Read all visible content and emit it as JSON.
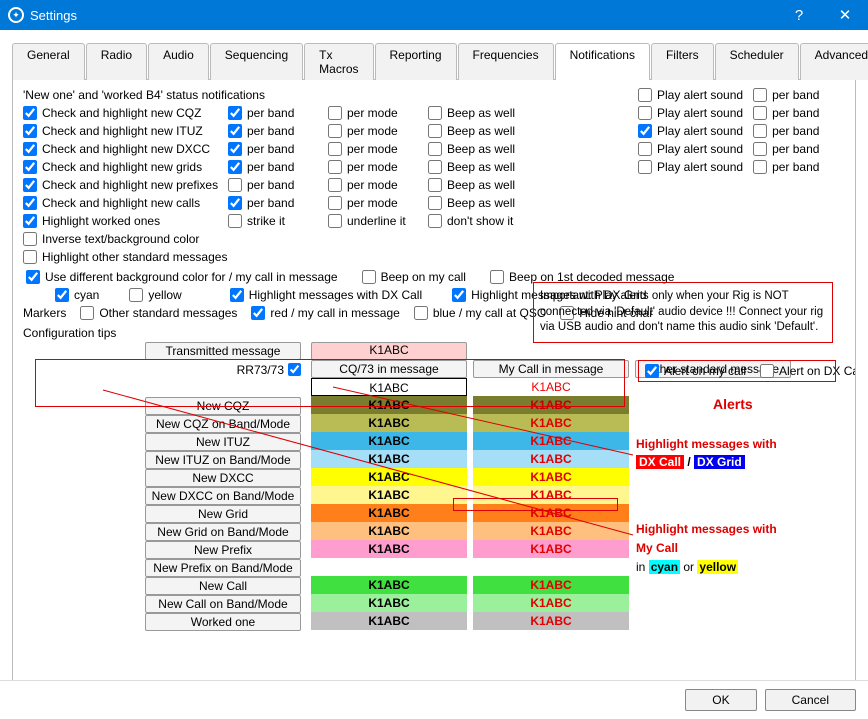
{
  "window": {
    "title": "Settings"
  },
  "tabs": [
    "General",
    "Radio",
    "Audio",
    "Sequencing",
    "Tx Macros",
    "Reporting",
    "Frequencies",
    "Notifications",
    "Filters",
    "Scheduler",
    "Advanced"
  ],
  "active_tab": "Notifications",
  "section": "'New one' and 'worked B4' status notifications",
  "checks": {
    "rows": [
      {
        "c0": {
          "t": "Check and highlight new CQZ",
          "v": true
        },
        "c1": {
          "t": "per band",
          "v": true
        },
        "c2": {
          "t": "per mode",
          "v": false
        },
        "c3": {
          "t": "Beep as well",
          "v": false
        }
      },
      {
        "c0": {
          "t": "Check and highlight new ITUZ",
          "v": true
        },
        "c1": {
          "t": "per band",
          "v": true
        },
        "c2": {
          "t": "per mode",
          "v": false
        },
        "c3": {
          "t": "Beep as well",
          "v": false
        }
      },
      {
        "c0": {
          "t": "Check and highlight new DXCC",
          "v": true
        },
        "c1": {
          "t": "per band",
          "v": true
        },
        "c2": {
          "t": "per mode",
          "v": false
        },
        "c3": {
          "t": "Beep as well",
          "v": false
        }
      },
      {
        "c0": {
          "t": "Check and highlight new grids",
          "v": true
        },
        "c1": {
          "t": "per band",
          "v": true
        },
        "c2": {
          "t": "per mode",
          "v": false
        },
        "c3": {
          "t": "Beep as well",
          "v": false
        }
      },
      {
        "c0": {
          "t": "Check and highlight new prefixes",
          "v": true
        },
        "c1": {
          "t": "per band",
          "v": false
        },
        "c2": {
          "t": "per mode",
          "v": false
        },
        "c3": {
          "t": "Beep as well",
          "v": false
        }
      },
      {
        "c0": {
          "t": "Check and highlight new calls",
          "v": true
        },
        "c1": {
          "t": "per band",
          "v": true
        },
        "c2": {
          "t": "per mode",
          "v": false
        },
        "c3": {
          "t": "Beep as well",
          "v": false
        }
      },
      {
        "c0": {
          "t": "Highlight worked ones",
          "v": true
        },
        "c1": {
          "t": "strike it",
          "v": false
        },
        "c2": {
          "t": "underline it",
          "v": false
        },
        "c3": {
          "t": "don't show it",
          "v": false
        }
      },
      {
        "c0": {
          "t": "Inverse text/background color",
          "v": false
        }
      },
      {
        "c0": {
          "t": "Highlight other standard messages",
          "v": false
        }
      }
    ],
    "diff_bg": {
      "t": "Use different background color for / my call in message",
      "v": true
    },
    "beep_mycall": {
      "t": "Beep on my call",
      "v": false
    },
    "beep_first": {
      "t": "Beep on 1st decoded message",
      "v": false
    },
    "cyan": {
      "t": "cyan",
      "v": true
    },
    "yellow": {
      "t": "yellow",
      "v": false
    },
    "hl_dxcall": {
      "t": "Highlight messages with DX Call",
      "v": true
    },
    "hl_dxgrid": {
      "t": "Highlight messages with DX Grid",
      "v": true
    },
    "alert_mycall": {
      "t": "Alert on my call",
      "v": true
    },
    "alert_dxcall": {
      "t": "Alert on DX Call",
      "v": false
    }
  },
  "alerts_rows": [
    {
      "play": {
        "t": "Play alert sound",
        "v": false
      },
      "pb": {
        "t": "per band",
        "v": false
      }
    },
    {
      "play": {
        "t": "Play alert sound",
        "v": false
      },
      "pb": {
        "t": "per band",
        "v": false
      }
    },
    {
      "play": {
        "t": "Play alert sound",
        "v": true
      },
      "pb": {
        "t": "per band",
        "v": false
      }
    },
    {
      "play": {
        "t": "Play alert sound",
        "v": false
      },
      "pb": {
        "t": "per band",
        "v": false
      }
    },
    {
      "play": {
        "t": "Play alert sound",
        "v": false
      },
      "pb": {
        "t": "per band",
        "v": false
      }
    }
  ],
  "important": "Important: Play alerts only when your Rig is NOT connected via 'Default' audio device !!! Connect your rig via USB audio and don't name this audio sink 'Default'.",
  "markers": {
    "label": "Markers",
    "other": {
      "t": "Other standard messages",
      "v": false
    },
    "red": {
      "t": "red / my call in message",
      "v": true
    },
    "blue": {
      "t": "blue / my call at QSO",
      "v": false
    },
    "hide": {
      "t": "Hide hint char",
      "v": false
    }
  },
  "cfg_tips": "Configuration tips",
  "hdr": {
    "tx": "Transmitted message",
    "cq": "CQ/73 in message",
    "my": "My Call in message",
    "other": "Other standard message",
    "rr": "RR73/73",
    "rrv": true
  },
  "btns": [
    "New CQZ",
    "New CQZ on Band/Mode",
    "New ITUZ",
    "New ITUZ on Band/Mode",
    "New DXCC",
    "New DXCC on Band/Mode",
    "New Grid",
    "New Grid on Band/Mode",
    "New Prefix",
    "New Prefix on Band/Mode",
    "New Call",
    "New Call on Band/Mode",
    "Worked one"
  ],
  "call": "K1ABC",
  "colors": {
    "rows": [
      {
        "l": {
          "bg": "#ffffff",
          "fg": "#000000",
          "b": 1
        },
        "r": {
          "bg": "#ffffff",
          "fg": "#f00000"
        }
      },
      {
        "l": {
          "bg": "#7a7c2e",
          "fg": "#000000"
        },
        "r": {
          "bg": "#7a7c2e",
          "fg": "#c00000"
        }
      },
      {
        "l": {
          "bg": "#b9bb55",
          "fg": "#000000"
        },
        "r": {
          "bg": "#b9bb55",
          "fg": "#e00000"
        }
      },
      {
        "l": {
          "bg": "#3db7e8",
          "fg": "#000000"
        },
        "r": {
          "bg": "#3db7e8",
          "fg": "#e00000"
        }
      },
      {
        "l": {
          "bg": "#a5dff7",
          "fg": "#000000"
        },
        "r": {
          "bg": "#a5dff7",
          "fg": "#e00000"
        }
      },
      {
        "l": {
          "bg": "#ffff00",
          "fg": "#000000"
        },
        "r": {
          "bg": "#ffff00",
          "fg": "#e00000"
        }
      },
      {
        "l": {
          "bg": "#fff68f",
          "fg": "#000000"
        },
        "r": {
          "bg": "#fff68f",
          "fg": "#e00000"
        }
      },
      {
        "l": {
          "bg": "#ff7f1a",
          "fg": "#000000"
        },
        "r": {
          "bg": "#ff7f1a",
          "fg": "#e00000"
        }
      },
      {
        "l": {
          "bg": "#ffc07f",
          "fg": "#000000"
        },
        "r": {
          "bg": "#ffc07f",
          "fg": "#e00000"
        }
      },
      {
        "l": {
          "bg": "#ff9ece",
          "fg": "#000000"
        },
        "r": {
          "bg": "#ff9ece",
          "fg": "#e00000"
        }
      },
      {
        "l": {
          "bg": "#ffffff",
          "fg": "#ffffff",
          "blank": 1
        },
        "r": {
          "bg": "#ffffff",
          "fg": "#ffffff",
          "blank": 1
        }
      },
      {
        "l": {
          "bg": "#40e040",
          "fg": "#000000"
        },
        "r": {
          "bg": "#40e040",
          "fg": "#e00000"
        }
      },
      {
        "l": {
          "bg": "#9bf09b",
          "fg": "#000000"
        },
        "r": {
          "bg": "#9bf09b",
          "fg": "#e00000"
        }
      },
      {
        "l": {
          "bg": "#c0c0c0",
          "fg": "#000000"
        },
        "r": {
          "bg": "#c0c0c0",
          "fg": "#e00000"
        }
      }
    ]
  },
  "anno": {
    "alerts": "Alerts",
    "hl1a": "Highlight messages with",
    "dxcall": "DX Call",
    "sep": " / ",
    "dxgrid": "DX Grid",
    "hl2a": "Highlight messages with",
    "hl2b": "My Call",
    "hl2c": "in ",
    "cyan": "cyan",
    "or": "  or  ",
    "yellow": "yellow"
  },
  "ok": "OK",
  "cancel": "Cancel"
}
